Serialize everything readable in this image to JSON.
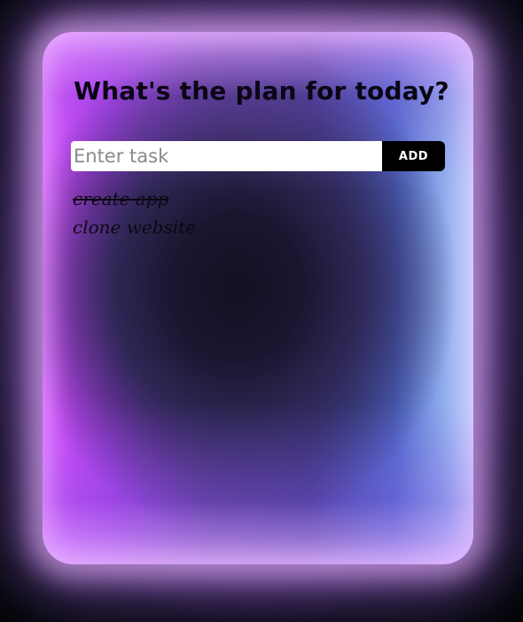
{
  "header": {
    "title": "What's the plan for today?"
  },
  "form": {
    "input_placeholder": "Enter task",
    "input_value": "",
    "add_label": "ADD"
  },
  "tasks": [
    {
      "text": "create app",
      "completed": true
    },
    {
      "text": "clone website",
      "completed": false
    }
  ],
  "colors": {
    "button_bg": "#000000",
    "button_text": "#ffffff",
    "input_bg": "#ffffff",
    "title_text": "#0a0614",
    "glow_purple": "#d84fff",
    "glow_blue": "#b7d6ff"
  }
}
